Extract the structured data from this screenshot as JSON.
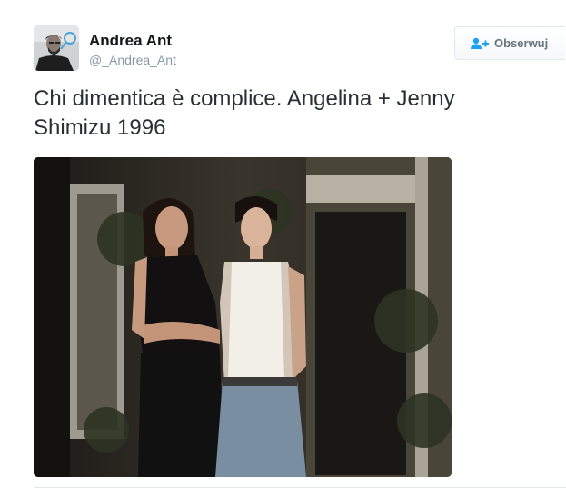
{
  "user": {
    "name": "Andrea Ant",
    "handle": "@_Andrea_Ant",
    "avatar_icon": "user-avatar"
  },
  "follow_button": {
    "label": "Obserwuj",
    "icon": "add-user-icon"
  },
  "tweet": {
    "text_line1": "Chi dimentica è complice. Angelina + Jenny",
    "text_line2": "Shimizu 1996"
  },
  "photo": {
    "icon": "tweet-photo"
  },
  "colors": {
    "text": "#292f33",
    "muted": "#8899a6",
    "accent": "#1da1f2",
    "border": "#e1e8ed"
  }
}
